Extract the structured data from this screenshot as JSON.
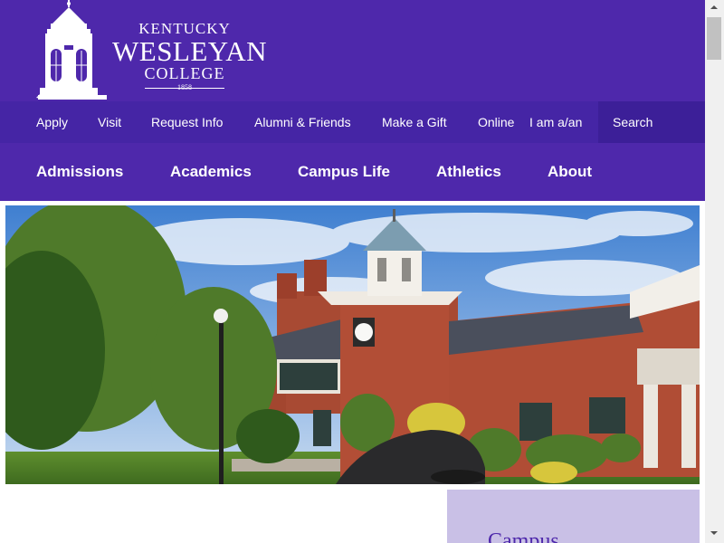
{
  "logo": {
    "line1": "KENTUCKY",
    "line2": "WESLEYAN",
    "line3": "COLLEGE",
    "year": "1858",
    "icon": "cupola-tower-icon"
  },
  "utility_nav": [
    {
      "label": "Apply"
    },
    {
      "label": "Visit"
    },
    {
      "label": "Request Info"
    },
    {
      "label": "Alumni & Friends"
    },
    {
      "label": "Make a Gift"
    },
    {
      "label": "Online"
    },
    {
      "label": "I am a/an"
    },
    {
      "label": "Search"
    }
  ],
  "main_nav": [
    {
      "label": "Admissions"
    },
    {
      "label": "Academics"
    },
    {
      "label": "Campus Life"
    },
    {
      "label": "Athletics"
    },
    {
      "label": "About"
    }
  ],
  "hero": {
    "image": "campus-brick-building-photo"
  },
  "side_card": {
    "title": "Campus"
  },
  "colors": {
    "brand_purple": "#4e28ab",
    "utility_purple": "#4525a5",
    "side_card_bg": "#c9c0e6"
  }
}
